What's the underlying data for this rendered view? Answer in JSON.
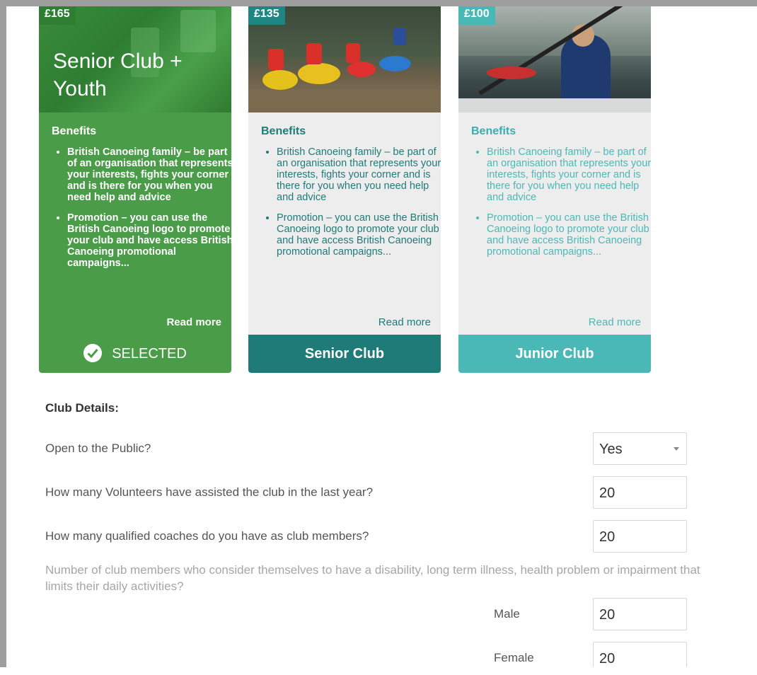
{
  "cards": [
    {
      "price": "£165",
      "title": "Senior Club + Youth",
      "benefits_heading": "Benefits",
      "benefits": [
        "British Canoeing family – be part of an organisation that represents your interests, fights your corner and is there for you when you need help and advice",
        "Promotion – you can use the British Canoeing logo to promote your club and have access British Canoeing promotional campaigns..."
      ],
      "read_more": "Read more",
      "footer": "SELECTED",
      "selected": true
    },
    {
      "price": "£135",
      "title": "",
      "benefits_heading": "Benefits",
      "benefits": [
        "British Canoeing family – be part of an organisation that represents your interests, fights your corner and is there for you when you need help and advice",
        "Promotion – you can use the British Canoeing logo to promote your club and have access British Canoeing promotional campaigns..."
      ],
      "read_more": "Read more",
      "footer": "Senior Club",
      "selected": false
    },
    {
      "price": "£100",
      "title": "",
      "benefits_heading": "Benefits",
      "benefits": [
        "British Canoeing family – be part of an organisation that represents your interests, fights your corner and is there for you when you need help and advice",
        "Promotion – you can use the British Canoeing logo to promote your club and have access British Canoeing promotional campaigns..."
      ],
      "read_more": "Read more",
      "footer": "Junior Club",
      "selected": false
    }
  ],
  "club_details": {
    "heading": "Club Details:",
    "open_to_public": {
      "label": "Open to the Public?",
      "value": "Yes"
    },
    "volunteers": {
      "label": "How many Volunteers have assisted the club in the last year?",
      "value": "20"
    },
    "coaches": {
      "label": "How many qualified coaches do you have as club members?",
      "value": "20"
    },
    "disability": {
      "label": "Number of club members who consider themselves to have a disability, long term illness, health problem or impairment that limits their daily activities?",
      "male_label": "Male",
      "male_value": "20",
      "female_label": "Female",
      "female_value": "20"
    }
  },
  "icons": {
    "selected": "check-circle-icon",
    "dropdown": "caret-down-icon"
  },
  "colors": {
    "selected_green": "#4a9c49",
    "senior_teal": "#1f7b78",
    "junior_teal": "#4ab8b6"
  }
}
